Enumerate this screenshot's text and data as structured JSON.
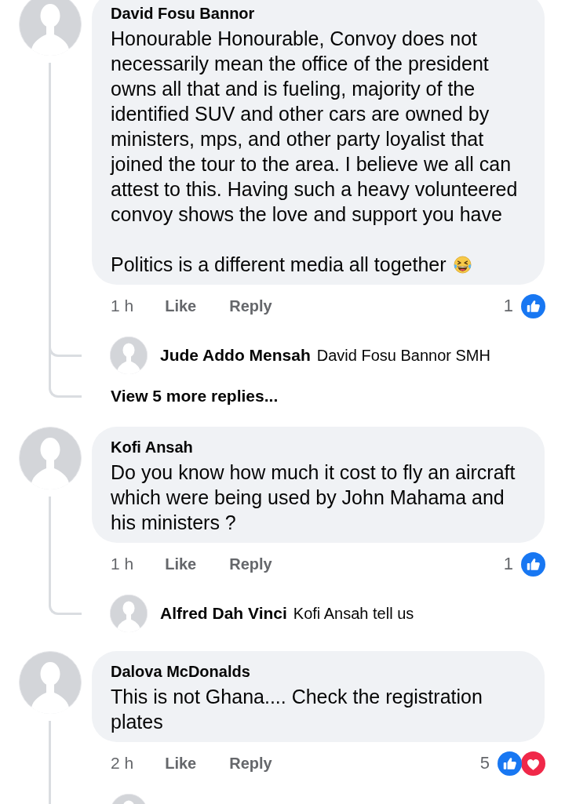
{
  "comments": [
    {
      "author": "David Fosu Bannor",
      "paragraphs": [
        "Honourable Honourable, Convoy does not necessarily mean the office of the president owns all that and is fueling, majority of the identified SUV and other cars are owned by ministers, mps, and other party loyalist that joined the tour to the area. I believe we all can attest to this. Having such a heavy volunteered convoy shows the love and support you have",
        "Politics is a different media all together"
      ],
      "trailing_emoji": true,
      "time": "1 h",
      "like_label": "Like",
      "reply_label": "Reply",
      "reaction_count": "1",
      "reactions": [
        {
          "kind": "like"
        }
      ],
      "replies": [
        {
          "author": "Jude Addo Mensah",
          "text": "David Fosu Bannor SMH"
        }
      ],
      "more_replies": "View 5 more replies..."
    },
    {
      "author": "Kofi Ansah",
      "paragraphs": [
        "Do you know how much it cost to fly an aircraft which were being used by John Mahama and his ministers ?"
      ],
      "time": "1 h",
      "like_label": "Like",
      "reply_label": "Reply",
      "reaction_count": "1",
      "reactions": [
        {
          "kind": "like"
        }
      ],
      "replies": [
        {
          "author": "Alfred Dah Vinci",
          "text": "Kofi Ansah tell us"
        }
      ]
    },
    {
      "author": "Dalova McDonalds",
      "paragraphs": [
        "This is not Ghana.... Check the registration plates"
      ],
      "time": "2 h",
      "like_label": "Like",
      "reply_label": "Reply",
      "reaction_count": "5",
      "reactions": [
        {
          "kind": "like"
        },
        {
          "kind": "love"
        }
      ],
      "next_reply_cut_off": true
    }
  ]
}
